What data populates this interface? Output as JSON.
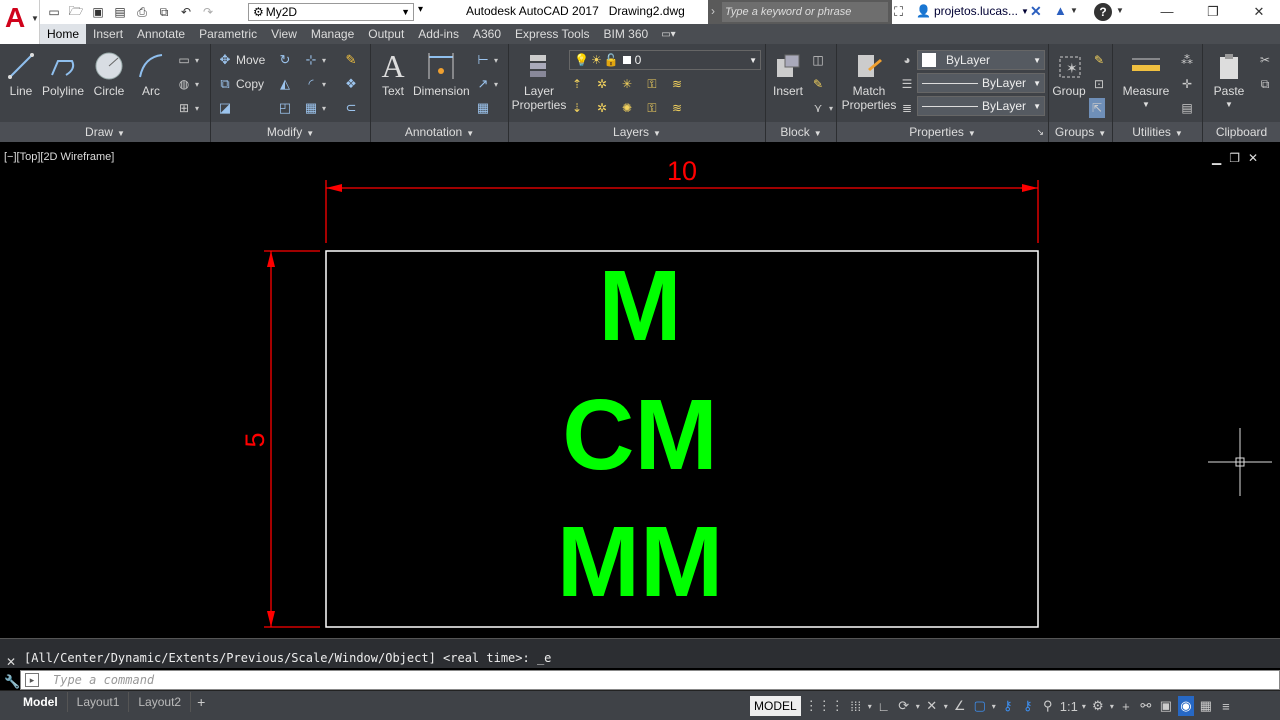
{
  "app": {
    "logo_letter": "A",
    "title": "Autodesk AutoCAD 2017",
    "drawing": "Drawing2.dwg"
  },
  "workspace": {
    "value": "My2D"
  },
  "search": {
    "placeholder": "Type a keyword or phrase"
  },
  "user": {
    "name": "projetos.lucas..."
  },
  "tabs": [
    "Home",
    "Insert",
    "Annotate",
    "Parametric",
    "View",
    "Manage",
    "Output",
    "Add-ins",
    "A360",
    "Express Tools",
    "BIM 360"
  ],
  "ribbon": {
    "draw": {
      "title": "Draw",
      "line": "Line",
      "polyline": "Polyline",
      "circle": "Circle",
      "arc": "Arc"
    },
    "modify": {
      "title": "Modify",
      "move": "Move",
      "copy": "Copy"
    },
    "annotation": {
      "title": "Annotation",
      "text": "Text",
      "dimension": "Dimension"
    },
    "layers": {
      "title": "Layers",
      "layer_properties_1": "Layer",
      "layer_properties_2": "Properties",
      "current_layer": "0"
    },
    "block": {
      "title": "Block",
      "insert": "Insert"
    },
    "properties": {
      "title": "Properties",
      "match_1": "Match",
      "match_2": "Properties",
      "color": "ByLayer",
      "linetype": "ByLayer",
      "lineweight": "ByLayer"
    },
    "groups": {
      "title": "Groups",
      "group": "Group"
    },
    "utilities": {
      "title": "Utilities",
      "measure": "Measure"
    },
    "clipboard": {
      "title": "Clipboard",
      "paste": "Paste"
    }
  },
  "viewport": {
    "label": "[−][Top][2D Wireframe]"
  },
  "drawing": {
    "dim_horizontal": "10",
    "dim_vertical": "5",
    "text_lines": [
      "M",
      "CM",
      "MM"
    ],
    "colors": {
      "dimension": "#ff0000",
      "text": "#00ff00",
      "rectangle": "#ffffff"
    }
  },
  "command": {
    "history": "[All/Center/Dynamic/Extents/Previous/Scale/Window/Object] <real time>: _e",
    "placeholder": "Type a command"
  },
  "status": {
    "layouts": [
      "Model",
      "Layout1",
      "Layout2"
    ],
    "model_button": "MODEL",
    "scale": "1:1"
  }
}
